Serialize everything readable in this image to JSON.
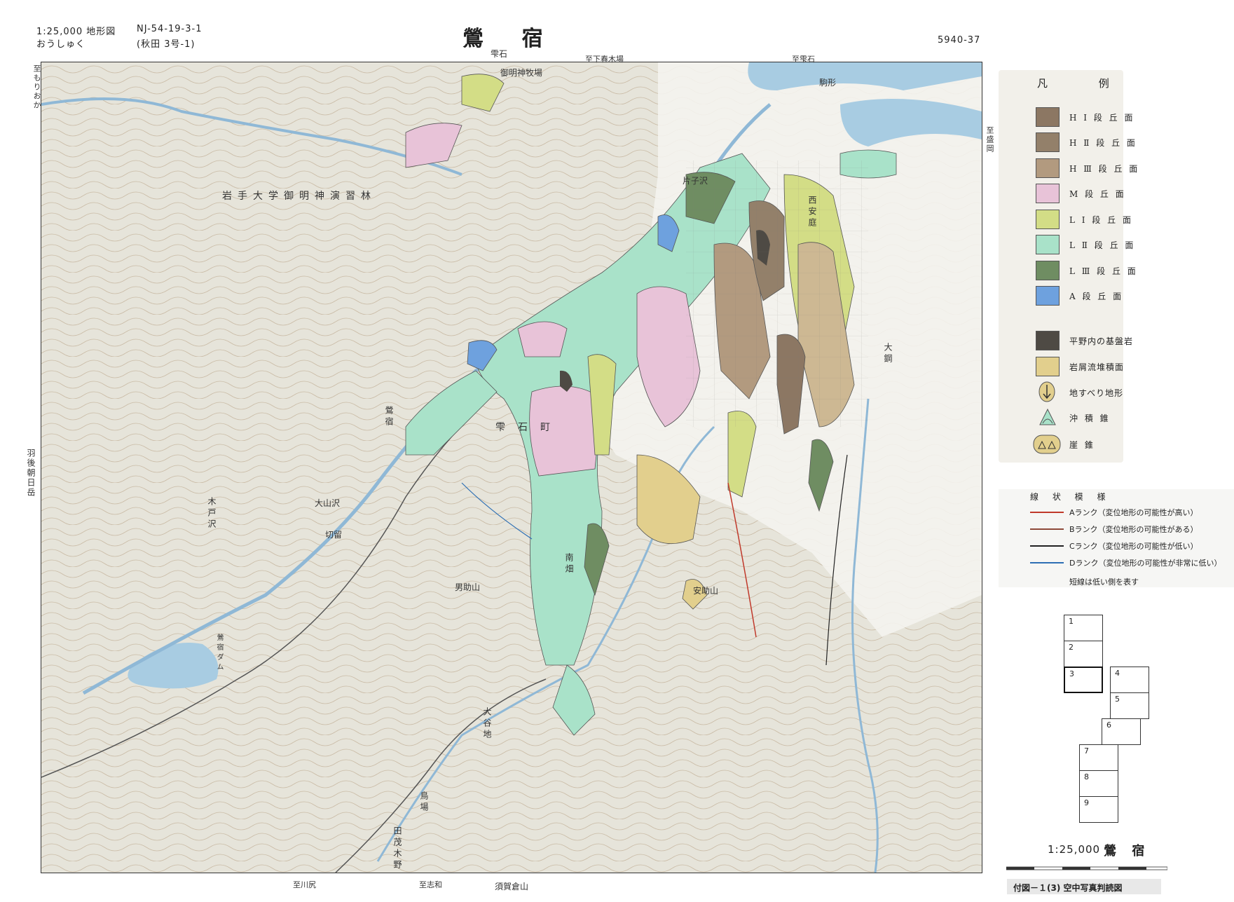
{
  "header": {
    "scale_line": "1:25,000 地形図",
    "reading": "おうしゅく",
    "code": "NJ-54-19-3-1",
    "sub_code": "(秋田 3号-1)",
    "title": "鶯 宿",
    "sheet_no": "5940-37"
  },
  "map": {
    "edge_labels": {
      "top_center": "雫石",
      "top_mid": "至下春木場",
      "top_right": "至雫石",
      "top_left": "至もりおか",
      "left_mid": "羽後朝日岳",
      "bottom_center": "須賀倉山",
      "bottom_left_road": "至川尻",
      "bottom_mid_road": "至志和",
      "right_roads": "至盛岡"
    },
    "places": {
      "forest": "岩手大学御明神演習林",
      "town": "雫石町",
      "village": "鶯宿",
      "mountain1": "男助山",
      "mountain2": "安助山",
      "south": "南畑",
      "stream1": "大山沢",
      "stream2": "木戸沢",
      "area1": "切留",
      "area2": "大谷地",
      "area3": "鳥場",
      "area4": "田茂木野",
      "area5": "片子沢",
      "area6": "西安庭",
      "area7": "大鋼",
      "area8": "駒形",
      "river1": "御明神牧場",
      "lake": "鶯宿ダム"
    },
    "colors": {
      "base": "#e6e4da",
      "contour": "#b8a58a",
      "water": "#a8cce2",
      "HI": "#8c7763",
      "HII": "#93806a",
      "HIII": "#b29a7f",
      "M": "#e8c3d8",
      "LI": "#d3dd86",
      "LII": "#a9e2c9",
      "LIII": "#6f8d62",
      "A": "#6ea1de",
      "bedrock": "#4e4a44",
      "talus": "#e2cf8d"
    }
  },
  "legend": {
    "title": "凡 例",
    "items": [
      {
        "label": "H Ⅰ 段 丘 面",
        "color": "#8c7763"
      },
      {
        "label": "H Ⅱ 段 丘 面",
        "color": "#93806a"
      },
      {
        "label": "H Ⅲ 段 丘 面",
        "color": "#b29a7f"
      },
      {
        "label": "M 段 丘 面",
        "color": "#e8c3d8"
      },
      {
        "label": "L Ⅰ 段 丘 面",
        "color": "#d3dd86"
      },
      {
        "label": "L Ⅱ 段 丘 面",
        "color": "#a9e2c9"
      },
      {
        "label": "L Ⅲ 段 丘 面",
        "color": "#6f8d62"
      },
      {
        "label": "A 段 丘 面",
        "color": "#6ea1de"
      },
      {
        "label": "平野内の基盤岩",
        "color": "#4e4a44"
      },
      {
        "label": "岩屑流堆積面",
        "color": "#e2cf8d"
      },
      {
        "label": "地すべり地形",
        "icon": "landslide-icon"
      },
      {
        "label": "沖 積 錐",
        "icon": "alluvial-cone-icon"
      },
      {
        "label": "崖 錐",
        "icon": "talus-cone-icon"
      }
    ]
  },
  "lines_legend": {
    "title": "線 状 模 様",
    "items": [
      {
        "label": "Aランク（変位地形の可能性が高い）",
        "color": "#c0392b"
      },
      {
        "label": "Bランク（変位地形の可能性がある）",
        "color": "#8e4a3a"
      },
      {
        "label": "Cランク（変位地形の可能性が低い）",
        "color": "#222222"
      },
      {
        "label": "Dランク（変位地形の可能性が非常に低い）",
        "color": "#2d6fb4"
      }
    ],
    "note": "短線は低い側を表す"
  },
  "index_map": [
    "1",
    "2",
    "3",
    "4",
    "5",
    "6",
    "7",
    "8",
    "9"
  ],
  "footer": {
    "scale": "1:25,000",
    "name": "鶯 宿",
    "caption": "付図－１(3) 空中写真判読図"
  }
}
